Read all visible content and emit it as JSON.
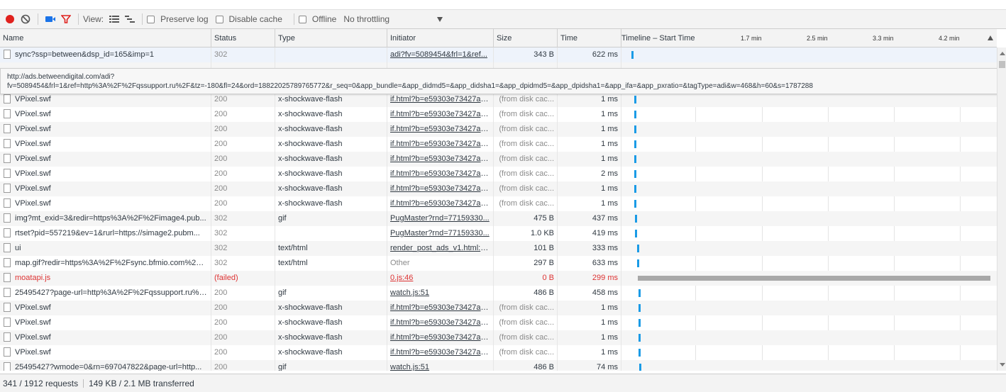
{
  "toolbar": {
    "view_label": "View:",
    "preserve_log_label": "Preserve log",
    "disable_cache_label": "Disable cache",
    "offline_label": "Offline",
    "throttling_label": "No throttling",
    "record_color": "#e0211d",
    "filter_color": "#e0211d",
    "camera_color": "#1a73e8"
  },
  "header": {
    "name": "Name",
    "status": "Status",
    "type": "Type",
    "initiator": "Initiator",
    "size": "Size",
    "time": "Time",
    "timeline": "Timeline – Start Time",
    "ticks": [
      "1.7 min",
      "2.5 min",
      "3.3 min",
      "4.2 min"
    ]
  },
  "tooltip": {
    "line1": "http://ads.betweendigital.com/adi?",
    "line2": "fv=5089454&frl=1&ref=http%3A%2F%2Fqssupport.ru%2F&tz=-180&fl=24&ord=18822025789765772&r_seq=0&app_bundle=&app_didmd5=&app_didsha1=&app_dpidmd5=&app_dpidsha1=&app_ifa=&app_pxratio=&tagType=adi&w=468&h=60&s=1787288"
  },
  "rows": [
    {
      "name": "sync?ssp=between&dsp_id=165&imp=1",
      "status": "302",
      "type": "",
      "initiator": "adi?fv=5089454&frl=1&ref...",
      "size": "343 B",
      "time": "622 ms",
      "bar_start": 0.026,
      "bar_len": 0.006,
      "selected": true
    },
    {
      "name": "",
      "status": "",
      "type": "",
      "initiator": "",
      "size": "",
      "time": "",
      "bar_start": 0.0,
      "bar_len": 0.0
    },
    {
      "name": "",
      "status": "",
      "type": "",
      "initiator": "",
      "size": "",
      "time": "",
      "bar_start": 0.0,
      "bar_len": 0.0
    },
    {
      "name": "VPixel.swf",
      "status": "200",
      "type": "x-shockwave-flash",
      "initiator": "if.html?b=e59303e73427a3...",
      "size": "(from disk cac...",
      "time": "1 ms",
      "bar_start": 0.034,
      "bar_len": 0.004
    },
    {
      "name": "VPixel.swf",
      "status": "200",
      "type": "x-shockwave-flash",
      "initiator": "if.html?b=e59303e73427a3...",
      "size": "(from disk cac...",
      "time": "1 ms",
      "bar_start": 0.034,
      "bar_len": 0.004
    },
    {
      "name": "VPixel.swf",
      "status": "200",
      "type": "x-shockwave-flash",
      "initiator": "if.html?b=e59303e73427a3...",
      "size": "(from disk cac...",
      "time": "1 ms",
      "bar_start": 0.034,
      "bar_len": 0.004
    },
    {
      "name": "VPixel.swf",
      "status": "200",
      "type": "x-shockwave-flash",
      "initiator": "if.html?b=e59303e73427a3...",
      "size": "(from disk cac...",
      "time": "1 ms",
      "bar_start": 0.034,
      "bar_len": 0.004
    },
    {
      "name": "VPixel.swf",
      "status": "200",
      "type": "x-shockwave-flash",
      "initiator": "if.html?b=e59303e73427a3...",
      "size": "(from disk cac...",
      "time": "1 ms",
      "bar_start": 0.034,
      "bar_len": 0.004
    },
    {
      "name": "VPixel.swf",
      "status": "200",
      "type": "x-shockwave-flash",
      "initiator": "if.html?b=e59303e73427a3...",
      "size": "(from disk cac...",
      "time": "2 ms",
      "bar_start": 0.034,
      "bar_len": 0.004
    },
    {
      "name": "VPixel.swf",
      "status": "200",
      "type": "x-shockwave-flash",
      "initiator": "if.html?b=e59303e73427a3...",
      "size": "(from disk cac...",
      "time": "1 ms",
      "bar_start": 0.034,
      "bar_len": 0.004
    },
    {
      "name": "VPixel.swf",
      "status": "200",
      "type": "x-shockwave-flash",
      "initiator": "if.html?b=e59303e73427a3...",
      "size": "(from disk cac...",
      "time": "1 ms",
      "bar_start": 0.034,
      "bar_len": 0.004
    },
    {
      "name": "img?mt_exid=3&redir=https%3A%2F%2Fimage4.pub...",
      "status": "302",
      "type": "gif",
      "initiator": "PugMaster?rnd=77159330...",
      "size": "475 B",
      "time": "437 ms",
      "bar_start": 0.036,
      "bar_len": 0.004
    },
    {
      "name": "rtset?pid=557219&ev=1&rurl=https://simage2.pubm...",
      "status": "302",
      "type": "",
      "initiator": "PugMaster?rnd=77159330...",
      "size": "1.0 KB",
      "time": "419 ms",
      "bar_start": 0.036,
      "bar_len": 0.004
    },
    {
      "name": "ui",
      "status": "302",
      "type": "text/html",
      "initiator": "render_post_ads_v1.html:-l...",
      "size": "101 B",
      "time": "333 ms",
      "bar_start": 0.042,
      "bar_len": 0.004
    },
    {
      "name": "map.gif?redir=https%3A%2F%2Fsync.bfmio.com%2Fs...",
      "status": "302",
      "type": "text/html",
      "initiator": "Other",
      "size": "297 B",
      "time": "633 ms",
      "bar_start": 0.042,
      "bar_len": 0.006,
      "initiator_muted": true
    },
    {
      "name": "moatapi.js",
      "status": "(failed)",
      "type": "",
      "initiator": "0.js:46",
      "size": "0 B",
      "time": "299 ms",
      "bar_start": 0.044,
      "bar_len": 0.94,
      "failed": true
    },
    {
      "name": "25495427?page-url=http%3A%2F%2Fqssupport.ru%2...",
      "status": "200",
      "type": "gif",
      "initiator": "watch.js:51",
      "size": "486 B",
      "time": "458 ms",
      "bar_start": 0.046,
      "bar_len": 0.004
    },
    {
      "name": "VPixel.swf",
      "status": "200",
      "type": "x-shockwave-flash",
      "initiator": "if.html?b=e59303e73427a3...",
      "size": "(from disk cac...",
      "time": "1 ms",
      "bar_start": 0.046,
      "bar_len": 0.004
    },
    {
      "name": "VPixel.swf",
      "status": "200",
      "type": "x-shockwave-flash",
      "initiator": "if.html?b=e59303e73427a3...",
      "size": "(from disk cac...",
      "time": "1 ms",
      "bar_start": 0.046,
      "bar_len": 0.004
    },
    {
      "name": "VPixel.swf",
      "status": "200",
      "type": "x-shockwave-flash",
      "initiator": "if.html?b=e59303e73427a3...",
      "size": "(from disk cac...",
      "time": "1 ms",
      "bar_start": 0.046,
      "bar_len": 0.004
    },
    {
      "name": "VPixel.swf",
      "status": "200",
      "type": "x-shockwave-flash",
      "initiator": "if.html?b=e59303e73427a3...",
      "size": "(from disk cac...",
      "time": "1 ms",
      "bar_start": 0.046,
      "bar_len": 0.004
    },
    {
      "name": "25495427?wmode=0&rn=697047822&page-url=http...",
      "status": "200",
      "type": "gif",
      "initiator": "watch.js:51",
      "size": "486 B",
      "time": "74 ms",
      "bar_start": 0.048,
      "bar_len": 0.004
    }
  ],
  "status_bar": {
    "requests": "341 / 1912 requests",
    "transferred": "149 KB / 2.1 MB transferred"
  },
  "colors": {
    "bar_blue": "#1a9be6",
    "bar_failed": "#a8a8a8"
  }
}
